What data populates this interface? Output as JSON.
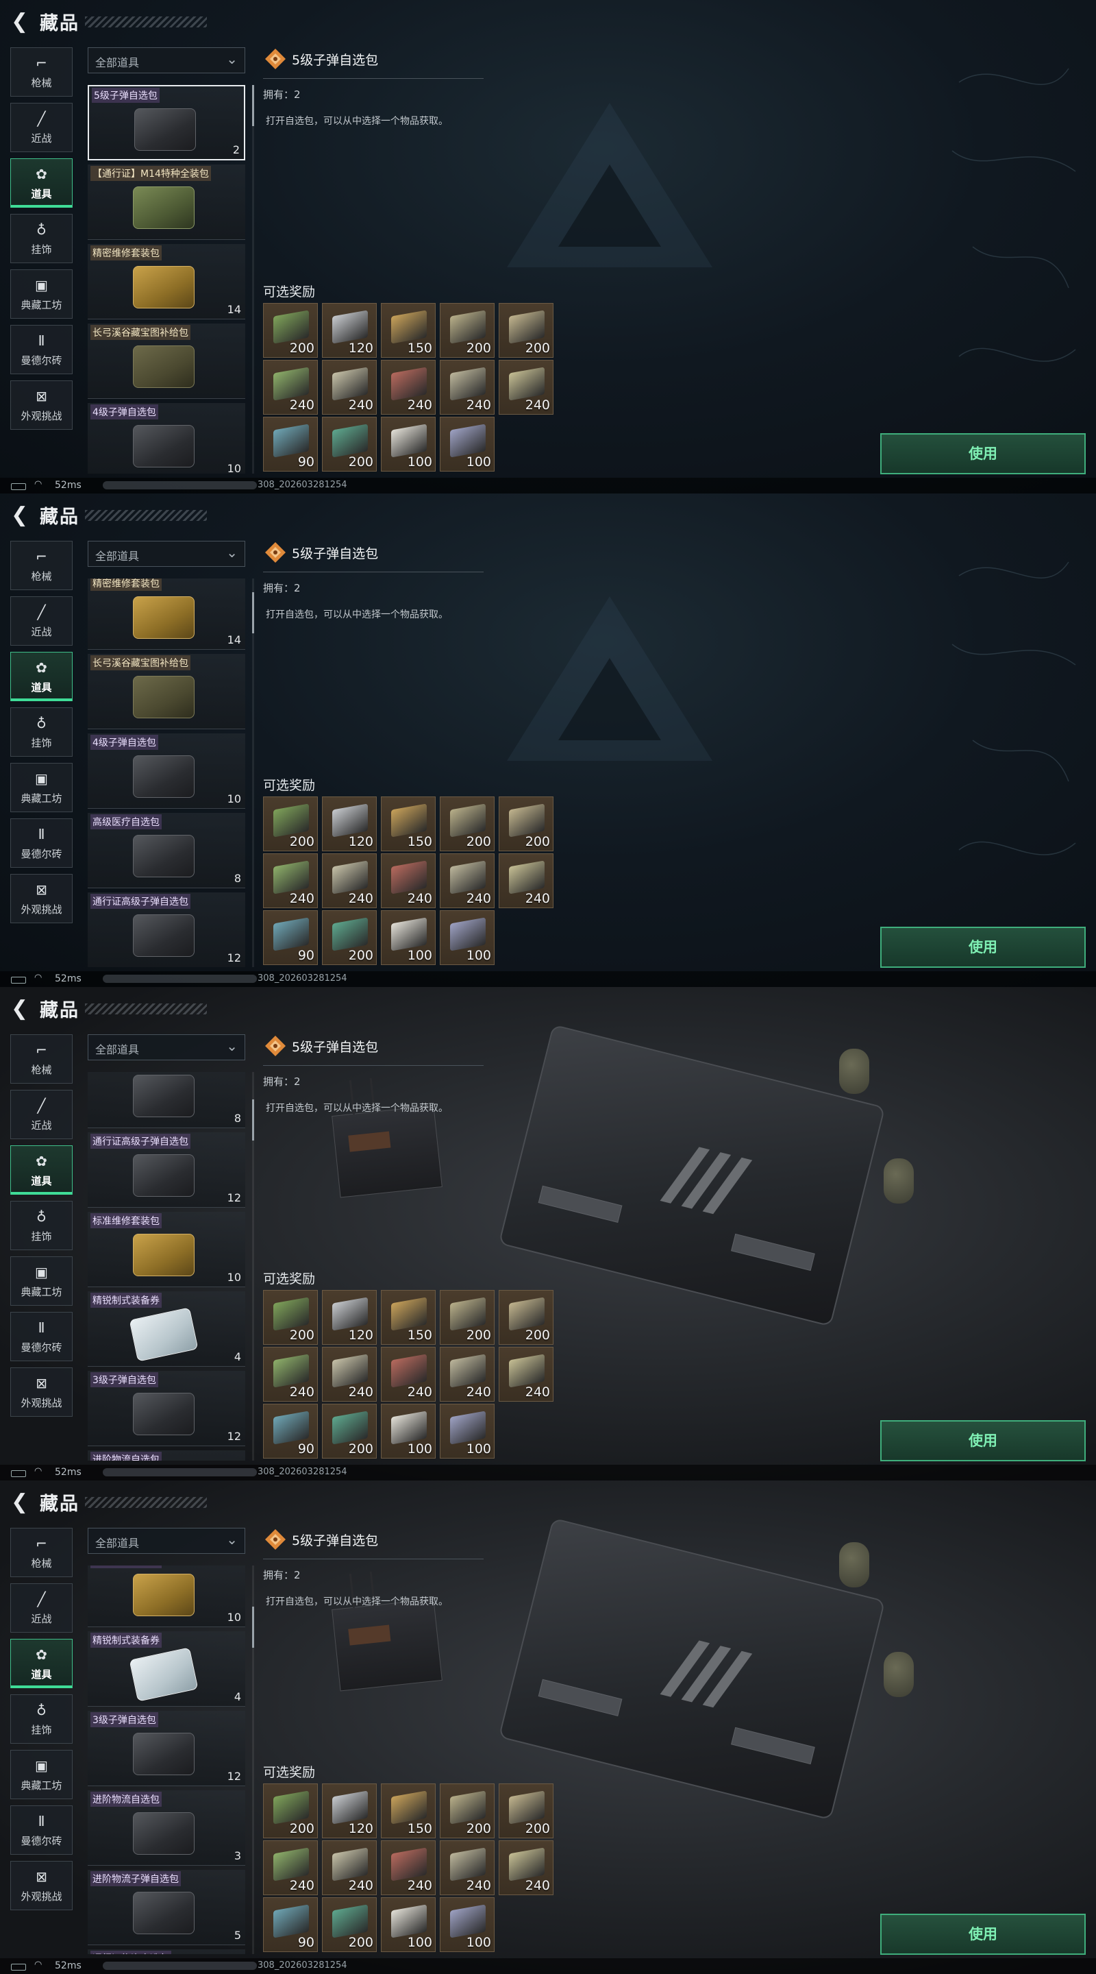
{
  "header": {
    "title": "藏品",
    "back_icon": "back-arrow-icon"
  },
  "sidebar": {
    "items": [
      {
        "label": "枪械",
        "icon": "pistol-icon",
        "glyph": "⌐"
      },
      {
        "label": "近战",
        "icon": "knife-icon",
        "glyph": "╱"
      },
      {
        "label": "道具",
        "icon": "items-icon",
        "glyph": "✿",
        "active": true
      },
      {
        "label": "挂饰",
        "icon": "charm-icon",
        "glyph": "♁"
      },
      {
        "label": "典藏工坊",
        "icon": "workshop-icon",
        "glyph": "▣"
      },
      {
        "label": "曼德尔砖",
        "icon": "brick-icon",
        "glyph": "Ⅱ"
      },
      {
        "label": "外观挑战",
        "icon": "challenge-icon",
        "glyph": "⊠"
      }
    ]
  },
  "filter": {
    "label": "全部道具",
    "icon": "chevron-down-icon"
  },
  "items": [
    {
      "name": "5级子弹自选包",
      "qty": "2",
      "art": "black",
      "tag": "purple"
    },
    {
      "name": "【通行证】M14特种全装包",
      "qty": "",
      "art": "green",
      "tag": "gold"
    },
    {
      "name": "精密维修套装包",
      "qty": "14",
      "art": "yellow",
      "tag": "gold"
    },
    {
      "name": "长弓溪谷藏宝图补给包",
      "qty": "",
      "art": "olive",
      "tag": "gold"
    },
    {
      "name": "4级子弹自选包",
      "qty": "10",
      "art": "black",
      "tag": "purple"
    },
    {
      "name": "高级医疗自选包",
      "qty": "8",
      "art": "black",
      "tag": "purple"
    },
    {
      "name": "通行证高级子弹自选包",
      "qty": "12",
      "art": "black",
      "tag": "purple"
    },
    {
      "name": "标准维修套装包",
      "qty": "10",
      "art": "yellow",
      "tag": "purple"
    },
    {
      "name": "精锐制式装备券",
      "qty": "4",
      "art": "white",
      "tag": "purple"
    },
    {
      "name": "3级子弹自选包",
      "qty": "12",
      "art": "black",
      "tag": "purple"
    },
    {
      "name": "进阶物流自选包",
      "qty": "3",
      "art": "black",
      "tag": "purple"
    },
    {
      "name": "进阶物流子弹自选包",
      "qty": "5",
      "art": "black",
      "tag": "purple"
    },
    {
      "name": "通行证物资自选包",
      "qty": "",
      "art": "black",
      "tag": "purple"
    }
  ],
  "detail": {
    "title": "5级子弹自选包",
    "owned": "拥有：2",
    "description": "打开自选包，可以从中选择一个物品获取。",
    "rewards_title": "可选奖励",
    "rewards": [
      {
        "qty": "200",
        "color": "#7fa35a"
      },
      {
        "qty": "120",
        "color": "#c8cbcf"
      },
      {
        "qty": "150",
        "color": "#c9a25a"
      },
      {
        "qty": "200",
        "color": "#b9b08a"
      },
      {
        "qty": "200",
        "color": "#c2b58e"
      },
      {
        "qty": "240",
        "color": "#8eb06a"
      },
      {
        "qty": "240",
        "color": "#c7c2a8"
      },
      {
        "qty": "240",
        "color": "#b86a5e"
      },
      {
        "qty": "240",
        "color": "#bdb79c"
      },
      {
        "qty": "240",
        "color": "#c6bf94"
      },
      {
        "qty": "90",
        "color": "#6fa6b5"
      },
      {
        "qty": "200",
        "color": "#5ea88e"
      },
      {
        "qty": "100",
        "color": "#e4e1d8"
      },
      {
        "qty": "100",
        "color": "#9ea2c4"
      }
    ],
    "use_label": "使用"
  },
  "status": {
    "ping": "52ms",
    "build": "308_202603281254"
  },
  "colors": {
    "accent": "#3fdc97",
    "use_text": "#7ff0b4",
    "panel_bg": "#0b0e12"
  }
}
